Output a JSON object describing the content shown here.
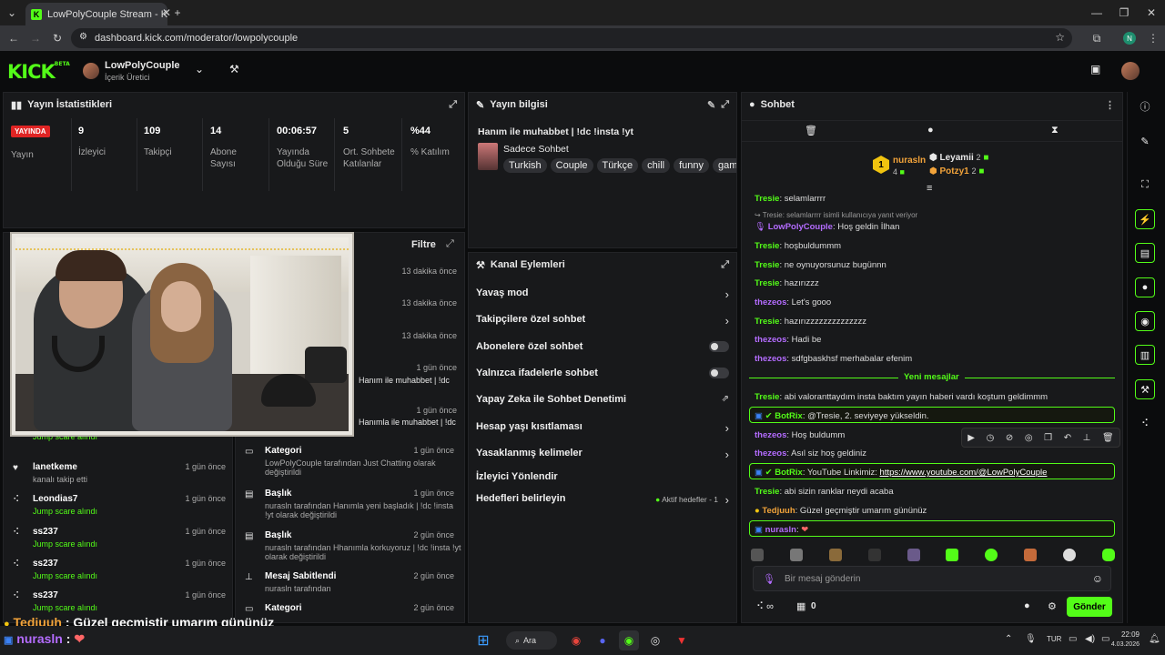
{
  "browser": {
    "tab_title": "LowPolyCouple Stream - Kick Da",
    "url": "dashboard.kick.com/moderator/lowpolycouple",
    "profile_initial": "N"
  },
  "header": {
    "logo": "KICK",
    "logo_badge": "BETA",
    "channel_name": "LowPolyCouple",
    "channel_role": "İçerik Üretici"
  },
  "stats": {
    "title": "Yayın İstatistikleri",
    "live_badge": "YAYINDA",
    "live_label": "Yayın",
    "items": [
      {
        "value": "9",
        "label": "İzleyici"
      },
      {
        "value": "109",
        "label": "Takipçi"
      },
      {
        "value": "14",
        "label": "Abone Sayısı"
      },
      {
        "value": "00:06:57",
        "label": "Yayında Olduğu Süre"
      },
      {
        "value": "5",
        "label": "Ort. Sohbete Katılanlar"
      },
      {
        "value": "%44",
        "label": "% Katılım"
      }
    ]
  },
  "stream_info": {
    "title": "Yayın bilgisi",
    "stream_title": "Hanım ile muhabbet | !dc !insta !yt",
    "category": "Sadece Sohbet",
    "tags": [
      "Turkish",
      "Couple",
      "Türkçe",
      "chill",
      "funny",
      "game"
    ]
  },
  "channel_actions": {
    "title": "Kanal Eylemleri",
    "items": [
      {
        "label": "Yavaş mod",
        "control": "chevron"
      },
      {
        "label": "Takipçilere özel sohbet",
        "control": "chevron"
      },
      {
        "label": "Abonelere özel sohbet",
        "control": "toggle"
      },
      {
        "label": "Yalnızca ifadelerle sohbet",
        "control": "toggle"
      },
      {
        "label": "Yapay Zeka ile Sohbet Denetimi",
        "control": "external"
      },
      {
        "label": "Hesap yaşı kısıtlaması",
        "control": "chevron"
      },
      {
        "label": "Yasaklanmış kelimeler",
        "control": "chevron"
      },
      {
        "label": "İzleyici Yönlendir",
        "control": "none"
      },
      {
        "label": "Hedefleri belirleyin",
        "control": "chevron",
        "extra": "Aktif hedefler - 1"
      }
    ]
  },
  "mod_log": {
    "filter": "Filtre",
    "times": [
      "13 dakika önce",
      "13 dakika önce",
      "13 dakika önce",
      "1 gün önce",
      "1 gün önce"
    ],
    "partial": [
      "Hanım ile muhabbet | !dc",
      "Hanımla ile muhabbet | !dc"
    ],
    "items": [
      {
        "title": "Kategori",
        "time": "1 gün önce",
        "l1": "LowPolyCouple tarafından Just Chatting olarak",
        "l2": "değiştirildi"
      },
      {
        "title": "Başlık",
        "time": "1 gün önce",
        "l1": "nurasln tarafından Hanımla yeni başladık | !dc !insta",
        "l2": "!yt olarak değiştirildi"
      },
      {
        "title": "Başlık",
        "time": "2 gün önce",
        "l1": "nurasln tarafından Hhanımla korkuyoruz | !dc !insta !yt",
        "l2": "olarak değiştirildi"
      },
      {
        "title": "Mesaj Sabitlendi",
        "time": "2 gün önce",
        "l1": "nurasln tarafından",
        "l2": ""
      },
      {
        "title": "Kategori",
        "time": "2 gün önce",
        "l1": "",
        "l2": ""
      }
    ]
  },
  "activity": {
    "items": [
      {
        "name": "",
        "sub": "Jump scare alındı",
        "time": ""
      },
      {
        "name": "lanetkeme",
        "sub": "kanalı takip etti",
        "time": "1 gün önce"
      },
      {
        "name": "Leondias7",
        "sub": "Jump scare alındı",
        "time": "1 gün önce"
      },
      {
        "name": "ss237",
        "sub": "Jump scare alındı",
        "time": "1 gün önce"
      },
      {
        "name": "ss237",
        "sub": "Jump scare alındı",
        "time": "1 gün önce"
      },
      {
        "name": "ss237",
        "sub": "Jump scare alındı",
        "time": "1 gün önce"
      }
    ]
  },
  "chat": {
    "title": "Sohbet",
    "leaderboard": [
      {
        "rank": "1",
        "name": "nurasln",
        "count": "4"
      },
      {
        "name": "Leyamii",
        "count": "2"
      },
      {
        "name": "Potzy1",
        "count": "2"
      }
    ],
    "messages": [
      {
        "user": "Tresie",
        "text": "selamlarrrr"
      },
      {
        "reply": "Tresie: selamlarrrr isimli kullanıcıya yanıt veriyor"
      },
      {
        "user": "LowPolyCouple",
        "text": "Hoş geldin İlhan"
      },
      {
        "user": "Tresie",
        "text": "hoşbuldummm"
      },
      {
        "user": "Tresie",
        "text": "ne oynuyorsunuz bugünnn"
      },
      {
        "user": "Tresie",
        "text": "hazırızzz"
      },
      {
        "user": "thezeos",
        "text": "Let's gooo"
      },
      {
        "user": "Tresie",
        "text": "hazırızzzzzzzzzzzzzz"
      },
      {
        "user": "thezeos",
        "text": "Hadi be"
      },
      {
        "user": "thezeos",
        "text": "sdfgbaskhsf merhabalar efenim"
      }
    ],
    "new_messages": "Yeni mesajlar",
    "new": [
      {
        "user": "Tresie",
        "text": "abi valoranttaydım insta baktım yayın haberi vardı koştum geldimmm"
      },
      {
        "user": "BotRix",
        "text": "@Tresie, 2. seviyeye yükseldin."
      },
      {
        "user": "thezeos",
        "text": "Hoş buldumm"
      },
      {
        "user": "thezeos",
        "text": "Asıl siz hoş geldiniz"
      },
      {
        "user": "BotRix",
        "text": "YouTube Linkimiz: ",
        "link": "https://www.youtube.com/@LowPolyCouple"
      },
      {
        "user": "Tresie",
        "text": "abi sizin ranklar neydi acaba"
      },
      {
        "user": "Tedjuuh",
        "text": "Güzel geçmiştir umarım gününüz"
      },
      {
        "user": "nurasln",
        "text": ""
      }
    ],
    "input_placeholder": "Bir mesaj gönderin",
    "points": "0",
    "send": "Gönder"
  },
  "overlay": {
    "line1_user": "Tedjuuh",
    "line1_text": " : Güzel geçmiştir umarım gününüz",
    "line2_user": "nurasln",
    "line2_text": " : "
  },
  "taskbar": {
    "search": "Ara",
    "lang": "TUR",
    "time": "22:09",
    "date": "4.03.2026"
  }
}
